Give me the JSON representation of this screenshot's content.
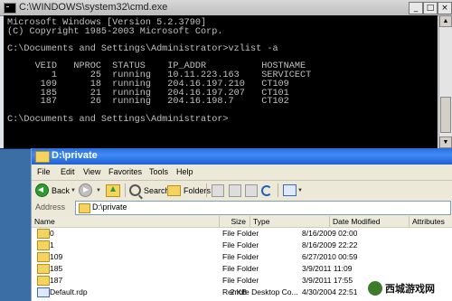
{
  "cmd": {
    "title": "C:\\WINDOWS\\system32\\cmd.exe",
    "lines": [
      "Microsoft Windows [Version 5.2.3790]",
      "(C) Copyright 1985-2003 Microsoft Corp.",
      "",
      "C:\\Documents and Settings\\Administrator>vzlist -a",
      "",
      "     VEID   NPROC  STATUS    IP_ADDR          HOSTNAME",
      "        1      25  running   10.11.223.163    SERVICECT",
      "      109      18  running   204.16.197.210   CT109",
      "      185      21  running   204.16.197.207   CT101",
      "      187      26  running   204.16.198.7     CT102",
      "",
      "C:\\Documents and Settings\\Administrator>"
    ],
    "minimize_glyph": "_",
    "maximize_glyph": "□",
    "close_glyph": "×"
  },
  "explorer": {
    "title": "D:\\private",
    "menu": [
      "File",
      "Edit",
      "View",
      "Favorites",
      "Tools",
      "Help"
    ],
    "toolbar": {
      "back_label": "Back",
      "search_label": "Search",
      "folders_label": "Folders"
    },
    "address": {
      "label": "Address",
      "value": "D:\\private"
    },
    "columns": [
      "Name",
      "Size",
      "Type",
      "Date Modified",
      "Attributes"
    ],
    "files": [
      {
        "name": "0",
        "size": "",
        "type": "File Folder",
        "date": "8/16/2009 02:00",
        "attributes": "",
        "icon": "folder-icon"
      },
      {
        "name": "1",
        "size": "",
        "type": "File Folder",
        "date": "8/16/2009 22:22",
        "attributes": "",
        "icon": "folder-icon"
      },
      {
        "name": "109",
        "size": "",
        "type": "File Folder",
        "date": "6/27/2010 00:59",
        "attributes": "",
        "icon": "folder-icon"
      },
      {
        "name": "185",
        "size": "",
        "type": "File Folder",
        "date": "3/9/2011 11:09",
        "attributes": "",
        "icon": "folder-icon"
      },
      {
        "name": "187",
        "size": "",
        "type": "File Folder",
        "date": "3/9/2011 17:55",
        "attributes": "",
        "icon": "folder-icon"
      },
      {
        "name": "Default.rdp",
        "size": "2 KB",
        "type": "Remote Desktop Co...",
        "date": "4/30/2004 22:51",
        "attributes": "",
        "icon": "rdp-file-icon"
      }
    ]
  },
  "watermark": {
    "text": "西城游戏网"
  }
}
